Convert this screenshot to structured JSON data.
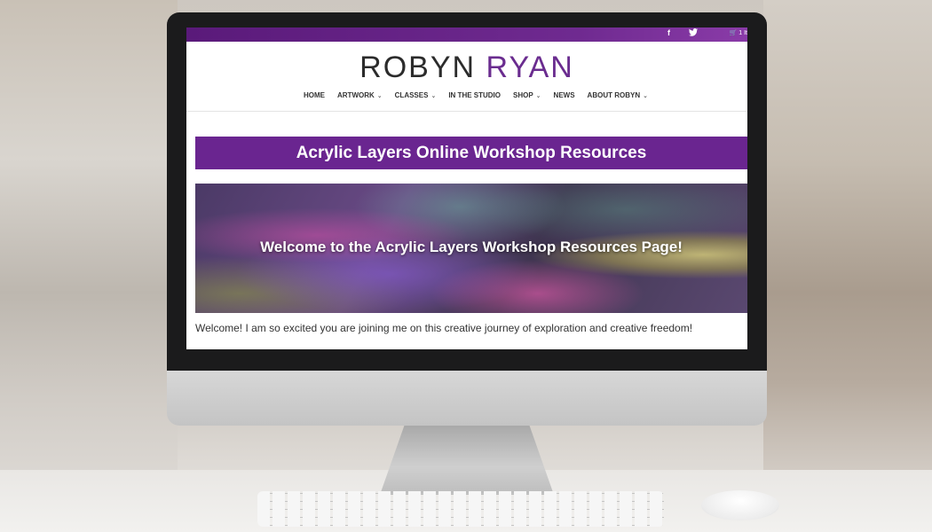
{
  "site": {
    "logo_first": "ROBYN",
    "logo_last": "RYAN",
    "brand_color": "#6a2590"
  },
  "topbar": {
    "facebook_icon": "f",
    "twitter_icon": "🐦",
    "cart_text": "1 It"
  },
  "nav": {
    "items": [
      {
        "label": "HOME",
        "dropdown": false
      },
      {
        "label": "ARTWORK",
        "dropdown": true
      },
      {
        "label": "CLASSES",
        "dropdown": true
      },
      {
        "label": "IN THE STUDIO",
        "dropdown": false
      },
      {
        "label": "SHOP",
        "dropdown": true
      },
      {
        "label": "NEWS",
        "dropdown": false
      },
      {
        "label": "ABOUT ROBYN",
        "dropdown": true
      }
    ],
    "chevron": "⌄"
  },
  "banner": {
    "title": "Acrylic Layers Online Workshop Resources"
  },
  "hero": {
    "title": "Welcome to the Acrylic Layers Workshop Resources Page!"
  },
  "content": {
    "welcome_text": "Welcome!  I am so excited you are joining me on this creative journey of exploration and creative freedom!"
  }
}
